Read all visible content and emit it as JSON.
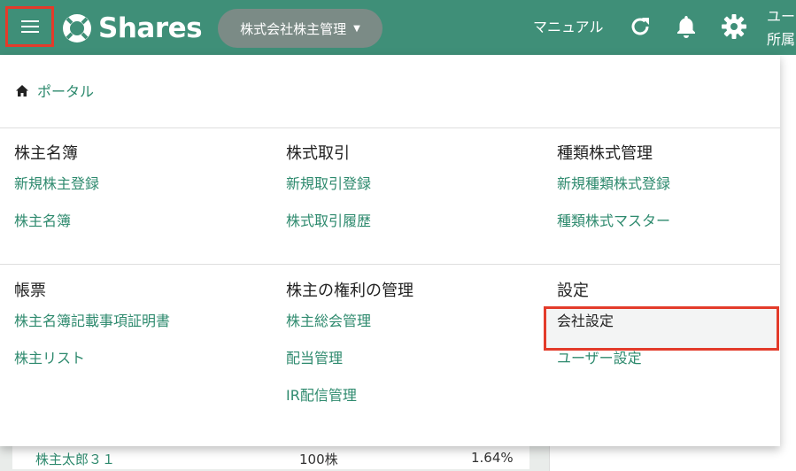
{
  "header": {
    "logo_text": "Shares",
    "company_select": "株式会社株主管理",
    "manual": "マニュアル",
    "user_line1": "ユー",
    "user_line2": "所属"
  },
  "background": {
    "row_name": "株主太郎３１",
    "row_shares": "100株",
    "row_percent": "1.64%"
  },
  "menu": {
    "portal": "ポータル",
    "sections": [
      {
        "title": "株主名簿",
        "links": [
          "新規株主登録",
          "株主名簿"
        ]
      },
      {
        "title": "株式取引",
        "links": [
          "新規取引登録",
          "株式取引履歴"
        ]
      },
      {
        "title": "種類株式管理",
        "links": [
          "新規種類株式登録",
          "種類株式マスター"
        ]
      },
      {
        "title": "帳票",
        "links": [
          "株主名簿記載事項証明書",
          "株主リスト"
        ]
      },
      {
        "title": "株主の権利の管理",
        "links": [
          "株主総会管理",
          "配当管理",
          "IR配信管理"
        ]
      },
      {
        "title": "設定",
        "links": [
          "会社設定",
          "ユーザー設定"
        ]
      }
    ]
  },
  "colors": {
    "header_bg": "#3f8f78",
    "link": "#2e8a6e",
    "highlight_border": "#e33b2a",
    "company_select_bg": "#7b8b86"
  }
}
